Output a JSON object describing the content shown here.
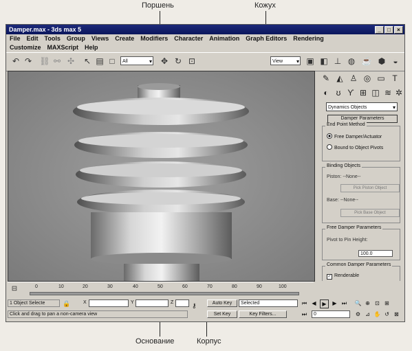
{
  "callouts": {
    "piston": "Поршень",
    "casing": "Кожух",
    "base": "Основание",
    "body": "Корпус"
  },
  "window": {
    "title": "Damper.max - 3ds max 5",
    "buttons": [
      "_",
      "□",
      "×"
    ]
  },
  "menu": {
    "row1": [
      "File",
      "Edit",
      "Tools",
      "Group",
      "Views",
      "Create",
      "Modifiers",
      "Character",
      "Animation",
      "Graph Editors",
      "Rendering"
    ],
    "row2": [
      "Customize",
      "MAXScript",
      "Help"
    ]
  },
  "toolbar": {
    "selection_filter": "All",
    "coord_system": "View"
  },
  "command_panel": {
    "tab_icons": [
      "create-icon",
      "modify-icon",
      "hierarchy-icon",
      "motion-icon",
      "display-icon",
      "utilities-icon"
    ],
    "category": "Dynamics Objects",
    "rollout_title": "Damper Parameters",
    "endpoint": {
      "label": "End Point Method",
      "opt1": "Free Damper/Actuator",
      "opt2": "Bound to Object Pivots",
      "selected": "Free Damper/Actuator"
    },
    "binding": {
      "label": "Binding Objects",
      "piston_text": "Piston: --None--",
      "piston_btn": "Pick Piston Object",
      "base_text": "Base: --None--",
      "base_btn": "Pick Base Object"
    },
    "free_params": {
      "label": "Free Damper Parameters",
      "height_label": "Pivot to Pin Height:",
      "height_value": "100.0"
    },
    "common": {
      "label": "Common Damper Parameters",
      "renderable": "Renderable"
    }
  },
  "timeline": {
    "ticks": [
      "0",
      "10",
      "20",
      "30",
      "40",
      "50",
      "60",
      "70",
      "80",
      "90",
      "100"
    ]
  },
  "status": {
    "selected_count": "1 Object Selecte",
    "x_label": "X",
    "y_label": "Y",
    "z_label": "Z",
    "hint": "Click and drag to pan a non-camera view",
    "auto_key": "Auto Key",
    "key_mode": "Selected",
    "set_key": "Set Key",
    "key_filters": "Key Filters...",
    "frame": "0"
  }
}
